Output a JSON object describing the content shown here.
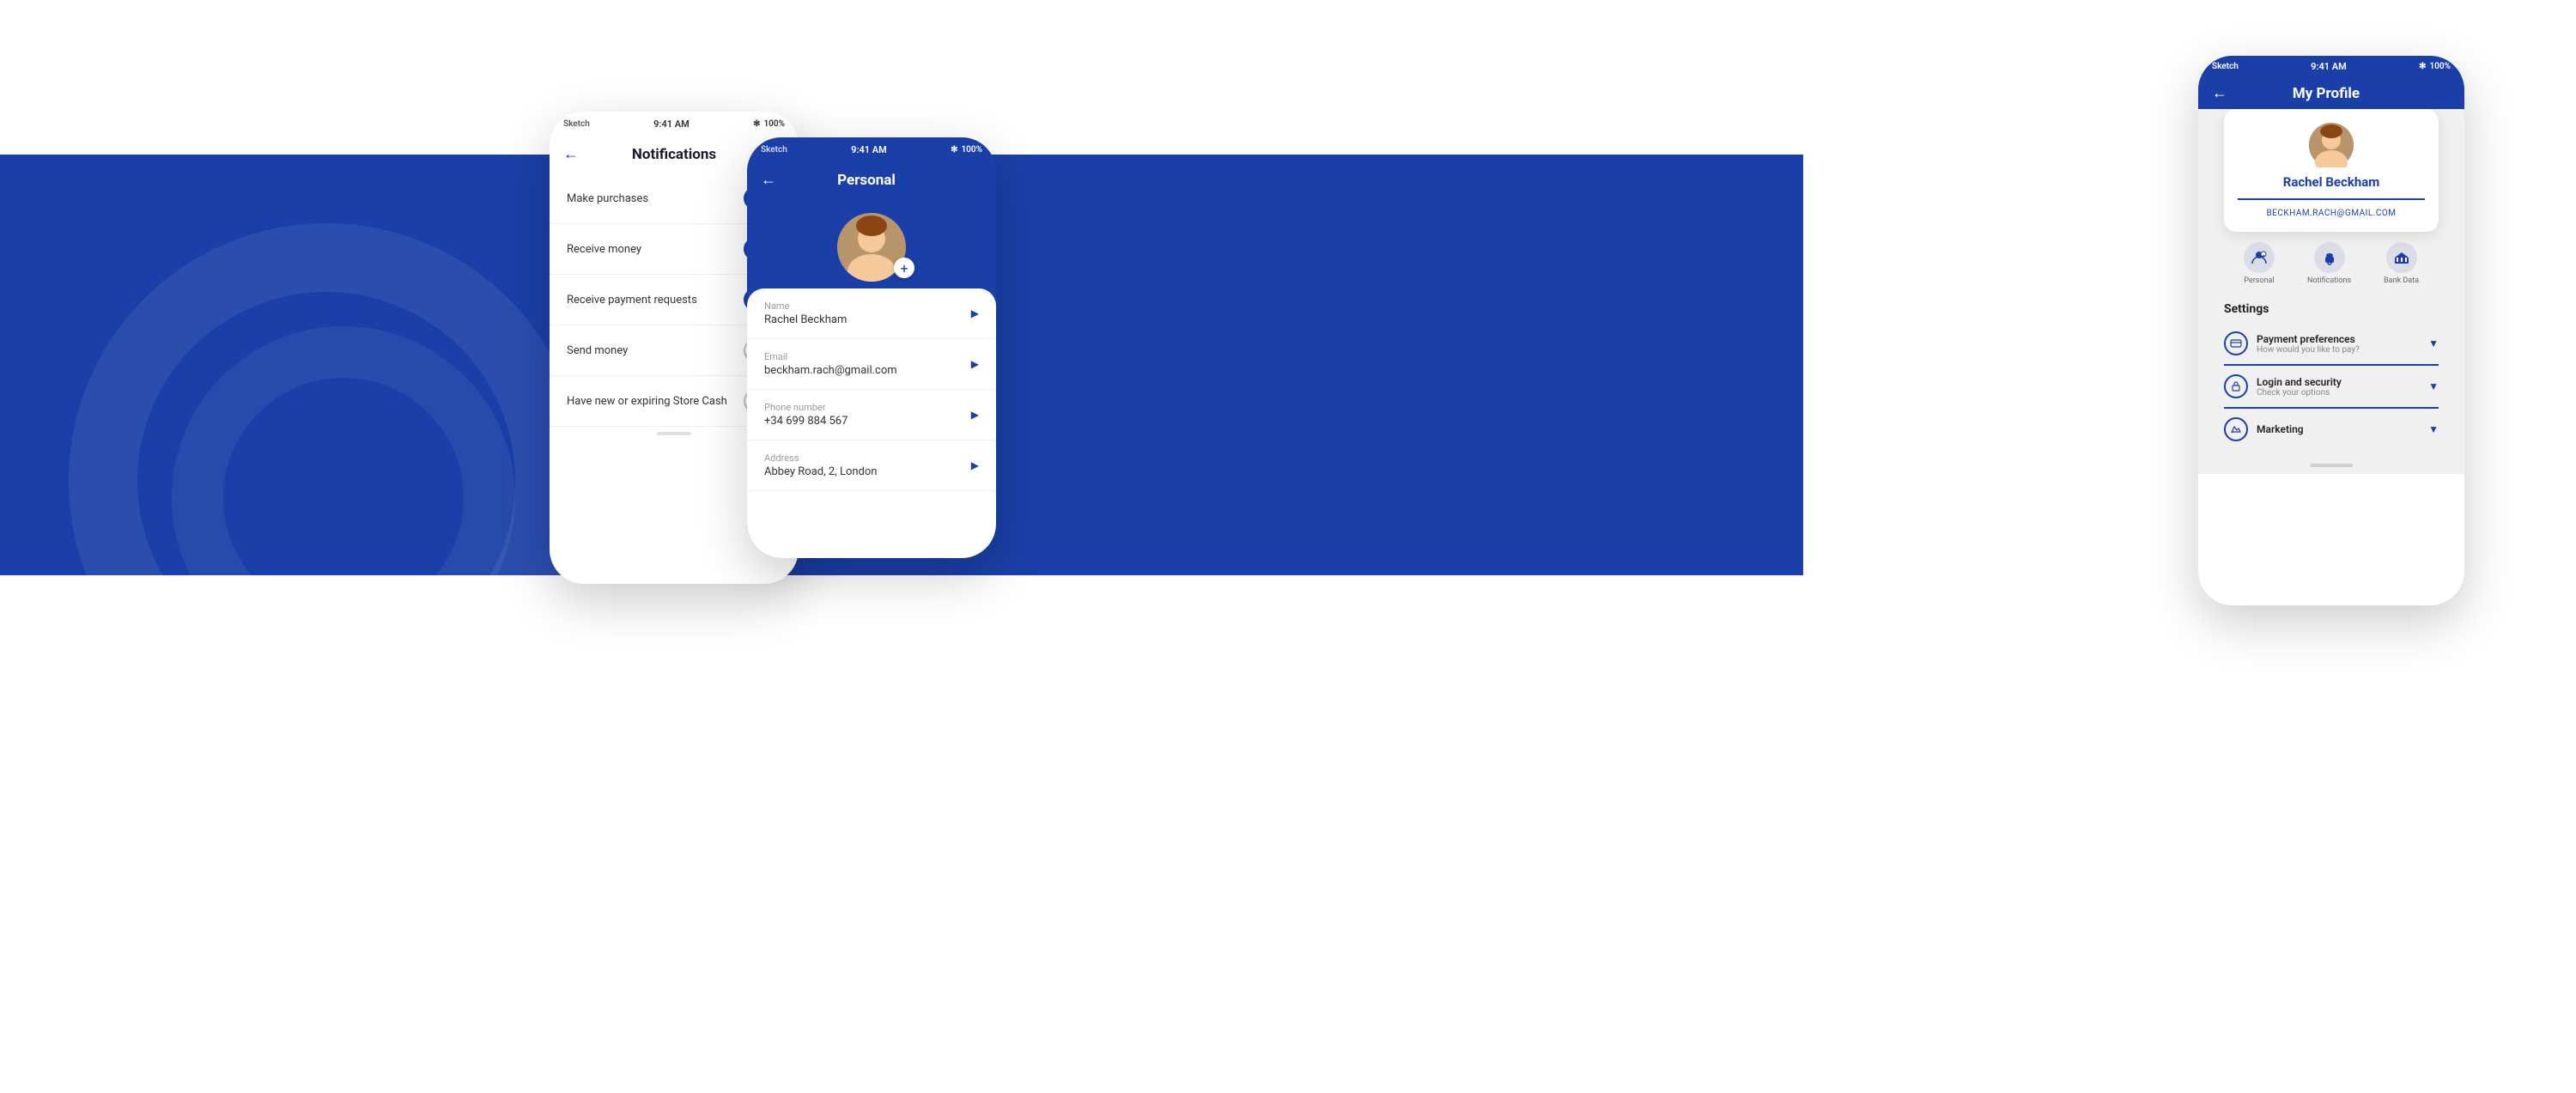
{
  "background": {
    "bannerColor": "#1a3fa8"
  },
  "phone_notifications": {
    "statusBar": {
      "signal": "Sketch",
      "wifi": "wifi",
      "time": "9:41 AM",
      "bluetooth": "✻",
      "battery": "100%"
    },
    "title": "Notifications",
    "backLabel": "←",
    "items": [
      {
        "label": "Make purchases",
        "enabled": true
      },
      {
        "label": "Receive money",
        "enabled": true
      },
      {
        "label": "Receive payment requests",
        "enabled": true
      },
      {
        "label": "Send money",
        "enabled": false
      },
      {
        "label": "Have new or expiring Store Cash",
        "enabled": false
      }
    ]
  },
  "phone_personal": {
    "statusBar": {
      "signal": "Sketch",
      "wifi": "wifi",
      "time": "9:41 AM",
      "bluetooth": "✻",
      "battery": "100%"
    },
    "title": "Personal",
    "backLabel": "←",
    "addLabel": "+",
    "fields": [
      {
        "label": "Name",
        "value": "Rachel Beckham"
      },
      {
        "label": "Email",
        "value": "beckham.rach@gmail.com"
      },
      {
        "label": "Phone number",
        "value": "+34 699 884 567"
      },
      {
        "label": "Address",
        "value": "Abbey Road, 2, London"
      }
    ]
  },
  "phone_profile": {
    "statusBar": {
      "signal": "Sketch",
      "wifi": "wifi",
      "time": "9:41 AM",
      "bluetooth": "✻",
      "battery": "100%"
    },
    "title": "My Profile",
    "backLabel": "←",
    "user": {
      "name": "Rachel Beckham",
      "email": "BECKHAM.RACH@GMAIL.COM"
    },
    "navIcons": [
      {
        "label": "Personal",
        "icon": "👤"
      },
      {
        "label": "Notifications",
        "icon": "🔔"
      },
      {
        "label": "Bank Data",
        "icon": "🏦"
      }
    ],
    "settingsTitle": "Settings",
    "settingsItems": [
      {
        "title": "Payment preferences",
        "subtitle": "How would you like to pay?",
        "icon": "💳"
      },
      {
        "title": "Login and security",
        "subtitle": "Check your options",
        "icon": "🔒"
      },
      {
        "title": "Marketing",
        "subtitle": "",
        "icon": "📊"
      }
    ]
  }
}
